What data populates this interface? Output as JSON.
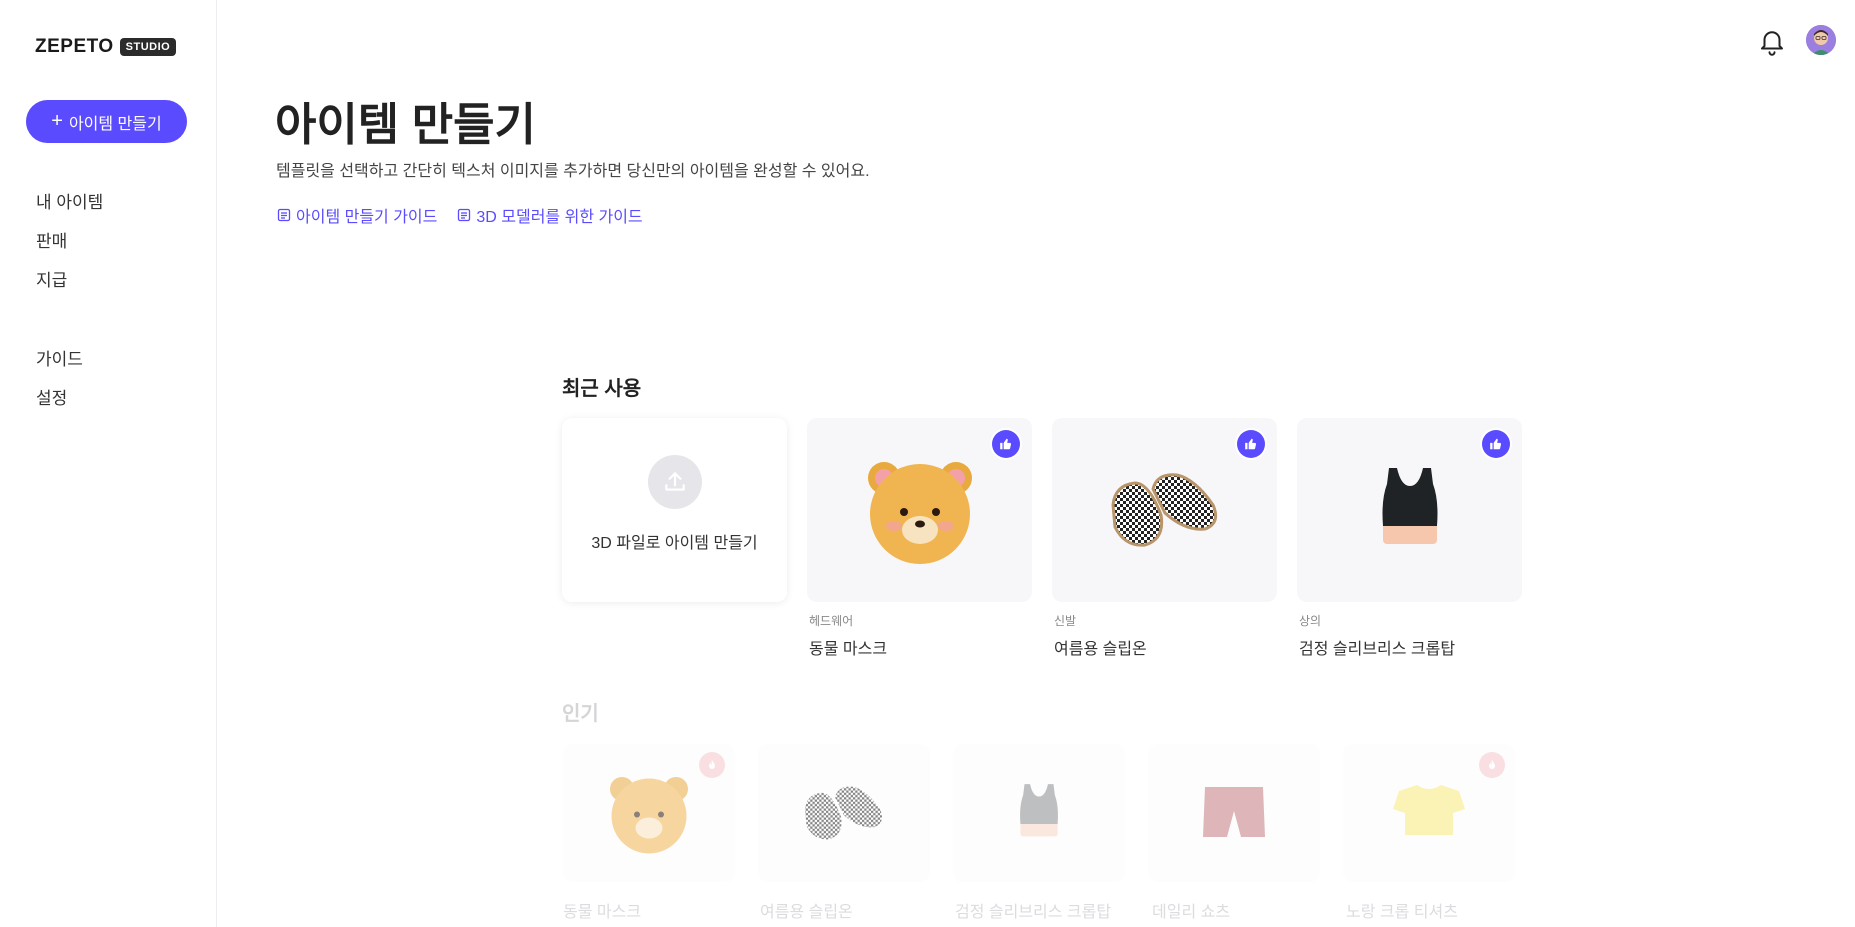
{
  "brand": {
    "name": "ZEPETO",
    "badge": "STUDIO"
  },
  "sidebar": {
    "create_label": "아이템 만들기",
    "items": [
      "내 아이템",
      "판매",
      "지급"
    ],
    "items2": [
      "가이드",
      "설정"
    ]
  },
  "header": {
    "title": "아이템 만들기",
    "subtitle": "템플릿을 선택하고 간단히 텍스처 이미지를 추가하면 당신만의 아이템을 완성할 수 있어요.",
    "guide_1": "아이템 만들기 가이드",
    "guide_2": "3D 모델러를 위한 가이드"
  },
  "recent": {
    "title": "최근 사용",
    "upload_label": "3D 파일로 아이템 만들기",
    "items": [
      {
        "category": "헤드웨어",
        "name": "동물 마스크"
      },
      {
        "category": "신발",
        "name": "여름용 슬립온"
      },
      {
        "category": "상의",
        "name": "검정 슬리브리스 크롭탑"
      }
    ]
  },
  "popular": {
    "title": "인기",
    "items": [
      {
        "name": "동물 마스크"
      },
      {
        "name": "여름용 슬립온"
      },
      {
        "name": "검정 슬리브리스 크롭탑"
      },
      {
        "name": "데일리 쇼츠"
      },
      {
        "name": "노랑 크롭 티셔츠"
      }
    ]
  },
  "colors": {
    "accent": "#5a4bff"
  },
  "icons": [
    "bell-icon",
    "upload-icon",
    "thumbs-up-icon",
    "fire-icon",
    "document-icon"
  ]
}
